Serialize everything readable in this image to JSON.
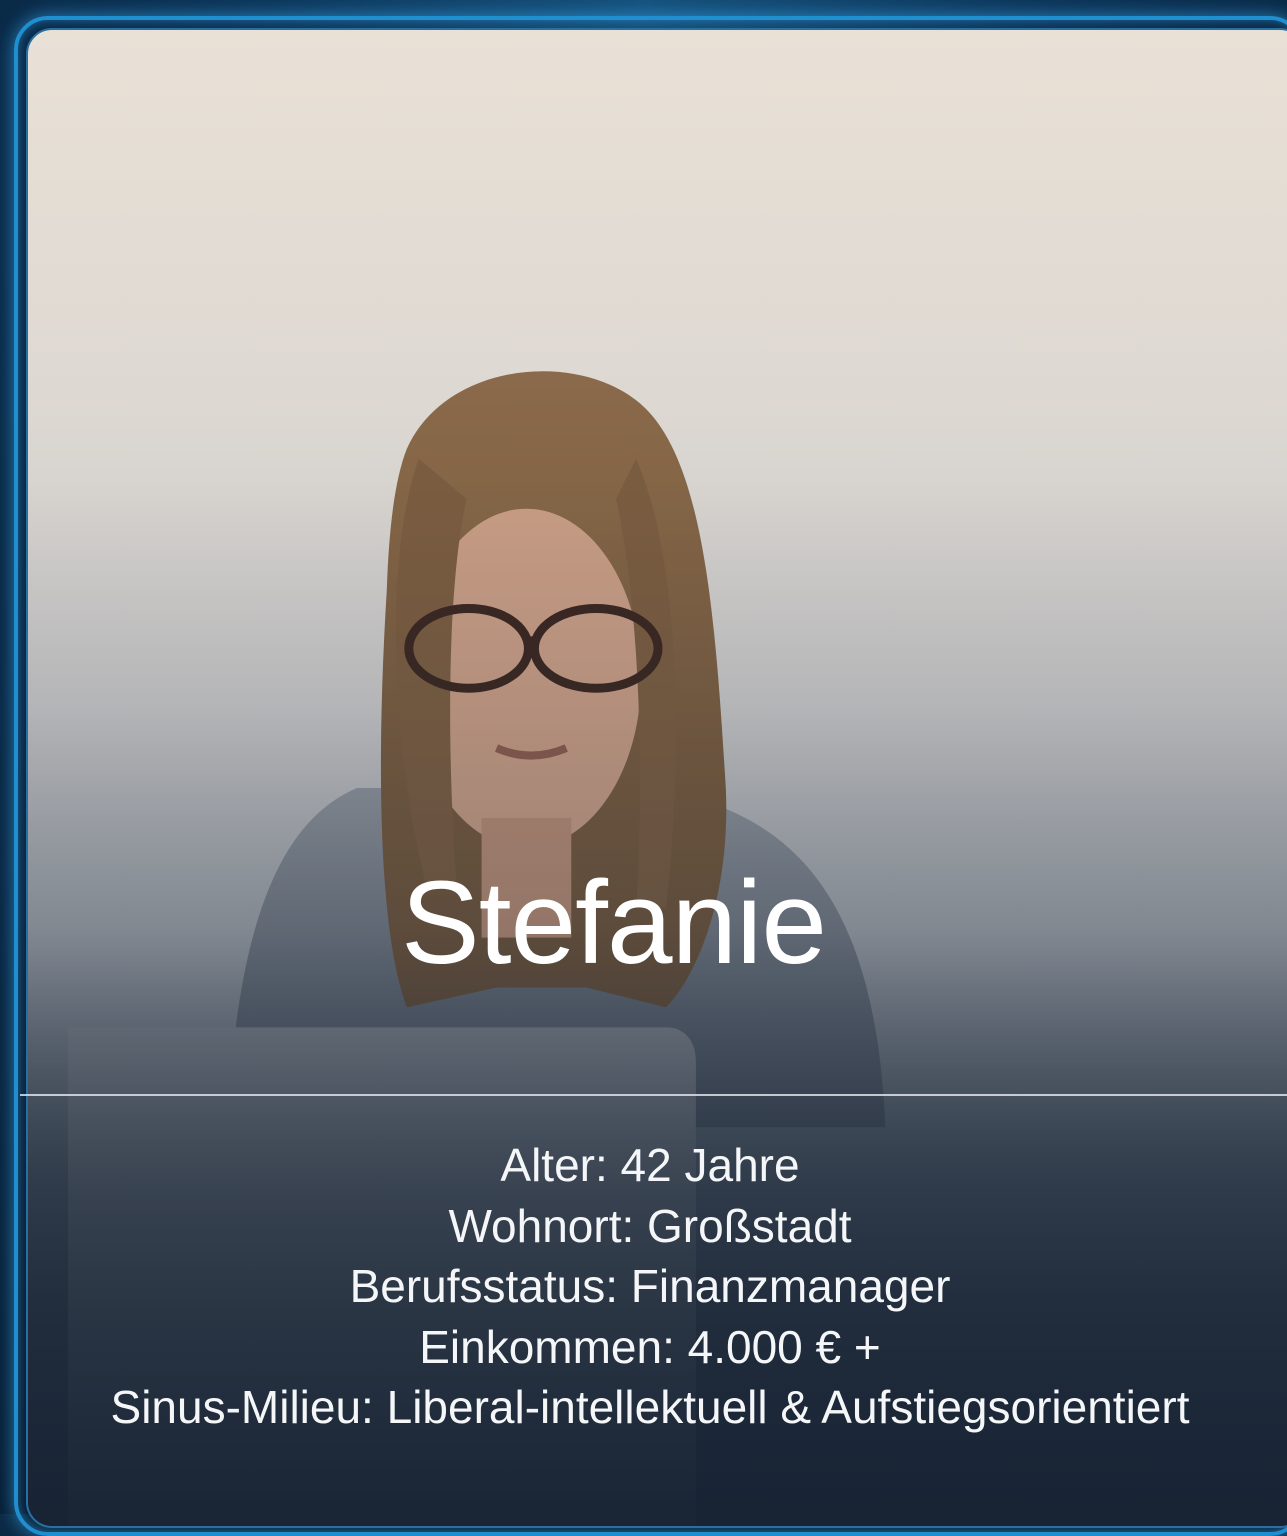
{
  "profile": {
    "name": "Stefanie",
    "photo_description_icon": "woman-with-glasses-at-laptop-photo",
    "details": {
      "alter": "Alter: 42 Jahre",
      "wohnort": "Wohnort: Großstadt",
      "berufsstatus": "Berufsstatus: Finanzmanager",
      "einkommen": "Einkommen: 4.000 € +",
      "sinus_milieu": "Sinus-Milieu: Liberal-intellektuell & Aufstiegsorientiert"
    }
  },
  "colors": {
    "frame_border": "#1f8fd0",
    "background": "#0b2a45",
    "text": "#ffffff"
  }
}
